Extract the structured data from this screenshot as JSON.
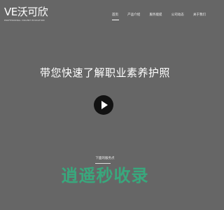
{
  "header": {
    "logo": {
      "mark": "VE沃可欣",
      "tagline": "PROFESSIONAL VIOLENT EDUCATION"
    },
    "nav": [
      {
        "label": "首页",
        "active": true
      },
      {
        "label": "产品介绍",
        "active": false
      },
      {
        "label": "服务能提",
        "active": false
      },
      {
        "label": "公司动态",
        "active": false
      },
      {
        "label": "关于我们",
        "active": false
      }
    ]
  },
  "hero": {
    "title": "带您快速了解职业素养护照",
    "play_icon": "play-icon"
  },
  "footer": {
    "label": "下面的服务点",
    "watermark": "逍遥秒收录"
  },
  "colors": {
    "background": "#666666",
    "text": "#ffffff",
    "play_button": "#121212",
    "watermark": "#39a87d"
  }
}
